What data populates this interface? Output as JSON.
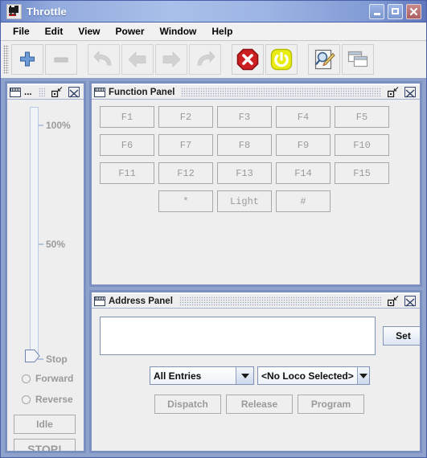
{
  "window": {
    "title": "Throttle",
    "icon": "locomotive-icon",
    "controls": {
      "minimize": "minimize-icon",
      "maximize": "maximize-icon",
      "close": "close-icon"
    }
  },
  "menubar": {
    "items": [
      "File",
      "Edit",
      "View",
      "Power",
      "Window",
      "Help"
    ]
  },
  "toolbar": {
    "buttons": [
      {
        "name": "add-throttle-button",
        "icon": "plus-icon",
        "enabled": true
      },
      {
        "name": "remove-throttle-button",
        "icon": "minus-icon",
        "enabled": false
      },
      {
        "name": "undo-button",
        "icon": "undo-arrow-icon",
        "enabled": false
      },
      {
        "name": "previous-button",
        "icon": "left-arrow-icon",
        "enabled": false
      },
      {
        "name": "next-button",
        "icon": "right-arrow-icon",
        "enabled": false
      },
      {
        "name": "redo-button",
        "icon": "redo-arrow-icon",
        "enabled": false
      },
      {
        "name": "emergency-stop-button",
        "icon": "stop-octagon-icon",
        "enabled": true
      },
      {
        "name": "power-button",
        "icon": "power-icon",
        "enabled": true
      },
      {
        "name": "edit-roster-button",
        "icon": "magnifier-pencil-icon",
        "enabled": true
      },
      {
        "name": "windows-button",
        "icon": "windows-stack-icon",
        "enabled": true
      }
    ]
  },
  "throttle_panel": {
    "title": "...",
    "ticks": [
      {
        "label": "100%",
        "value": 100
      },
      {
        "label": "50%",
        "value": 50
      },
      {
        "label": "Stop",
        "value": 0
      }
    ],
    "slider_value": 0,
    "directions": [
      {
        "label": "Forward",
        "selected": false
      },
      {
        "label": "Reverse",
        "selected": false
      }
    ],
    "buttons": [
      {
        "label": "Idle",
        "enabled": false
      },
      {
        "label": "STOP!",
        "enabled": false
      }
    ]
  },
  "function_panel": {
    "title": "Function Panel",
    "buttons": [
      "F1",
      "F2",
      "F3",
      "F4",
      "F5",
      "F6",
      "F7",
      "F8",
      "F9",
      "F10",
      "F11",
      "F12",
      "F13",
      "F14",
      "F15",
      "*",
      "Light",
      "#"
    ]
  },
  "address_panel": {
    "title": "Address Panel",
    "address_input_value": "",
    "set_button": "Set",
    "roster_filter": "All Entries",
    "loco_selector": "<No Loco Selected>",
    "buttons": [
      {
        "label": "Dispatch",
        "enabled": false
      },
      {
        "label": "Release",
        "enabled": false
      },
      {
        "label": "Program",
        "enabled": false
      }
    ]
  },
  "colors": {
    "titlebar_blue": "#93abdd",
    "desktop_blue": "#8ea2cc",
    "stop_red": "#cc2222",
    "power_yellow": "#e9ec13",
    "disabled_text": "#9a9a9a"
  }
}
